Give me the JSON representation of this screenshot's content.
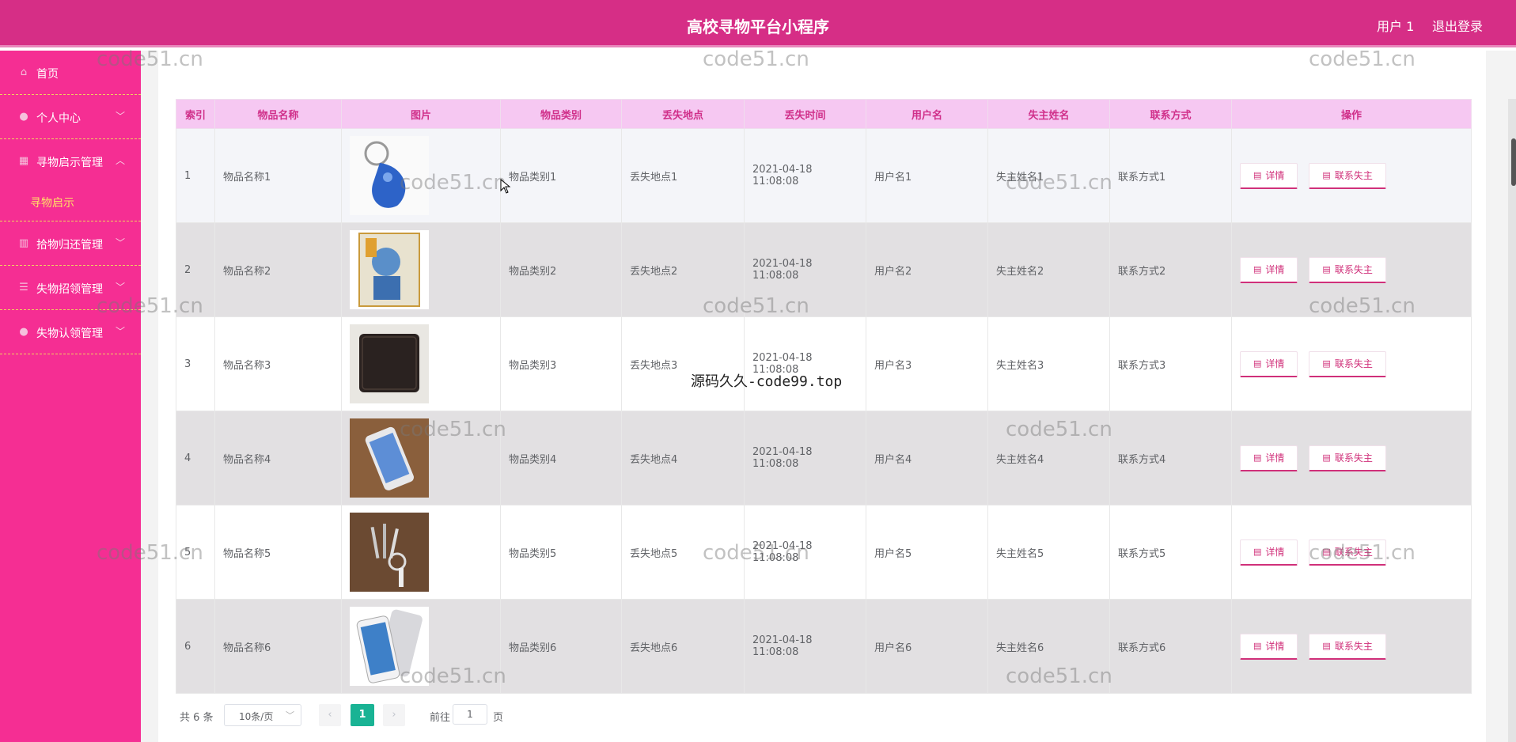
{
  "header": {
    "title": "高校寻物平台小程序",
    "user": "用户 1",
    "logout": "退出登录"
  },
  "sidebar": {
    "items": [
      {
        "label": "首页",
        "icon": "home-icon"
      },
      {
        "label": "个人中心",
        "icon": "user-icon"
      },
      {
        "label": "寻物启示管理",
        "icon": "grid-icon",
        "expanded": true
      },
      {
        "label": "拾物归还管理",
        "icon": "bar-icon"
      },
      {
        "label": "失物招领管理",
        "icon": "sliders-icon"
      },
      {
        "label": "失物认领管理",
        "icon": "user-icon"
      }
    ],
    "sub_item": "寻物启示"
  },
  "table": {
    "columns": [
      "索引",
      "物品名称",
      "图片",
      "物品类别",
      "丢失地点",
      "丢失时间",
      "用户名",
      "失主姓名",
      "联系方式",
      "操作"
    ],
    "rows": [
      {
        "index": "1",
        "name": "物品名称1",
        "image": "blue-keyfob",
        "category": "物品类别1",
        "place": "丢失地点1",
        "time": "2021-04-18 11:08:08",
        "username": "用户名1",
        "owner": "失主姓名1",
        "contact": "联系方式1"
      },
      {
        "index": "2",
        "name": "物品名称2",
        "image": "book-cover",
        "category": "物品类别2",
        "place": "丢失地点2",
        "time": "2021-04-18 11:08:08",
        "username": "用户名2",
        "owner": "失主姓名2",
        "contact": "联系方式2"
      },
      {
        "index": "3",
        "name": "物品名称3",
        "image": "wallet",
        "category": "物品类别3",
        "place": "丢失地点3",
        "time": "2021-04-18 11:08:08",
        "username": "用户名3",
        "owner": "失主姓名3",
        "contact": "联系方式3"
      },
      {
        "index": "4",
        "name": "物品名称4",
        "image": "phone",
        "category": "物品类别4",
        "place": "丢失地点4",
        "time": "2021-04-18 11:08:08",
        "username": "用户名4",
        "owner": "失主姓名4",
        "contact": "联系方式4"
      },
      {
        "index": "5",
        "name": "物品名称5",
        "image": "keys",
        "category": "物品类别5",
        "place": "丢失地点5",
        "time": "2021-04-18 11:08:08",
        "username": "用户名5",
        "owner": "失主姓名5",
        "contact": "联系方式5"
      },
      {
        "index": "6",
        "name": "物品名称6",
        "image": "phone-white",
        "category": "物品类别6",
        "place": "丢失地点6",
        "time": "2021-04-18 11:08:08",
        "username": "用户名6",
        "owner": "失主姓名6",
        "contact": "联系方式6"
      }
    ],
    "actions": {
      "detail": "详情",
      "contact_owner": "联系失主"
    }
  },
  "pagination": {
    "total": "共 6 条",
    "page_size": "10条/页",
    "current_page": "1",
    "goto_prefix": "前往",
    "goto_value": "1",
    "goto_suffix": "页"
  },
  "watermarks": {
    "site": "code51.cn",
    "source": "源码久久-code99.top"
  },
  "colors": {
    "header": "#d62e86",
    "sidebar": "#f52e93",
    "table_header": "#f6c8f2",
    "accent": "#d0307a",
    "page_active": "#19b394",
    "submenu_text": "#ffe066"
  }
}
